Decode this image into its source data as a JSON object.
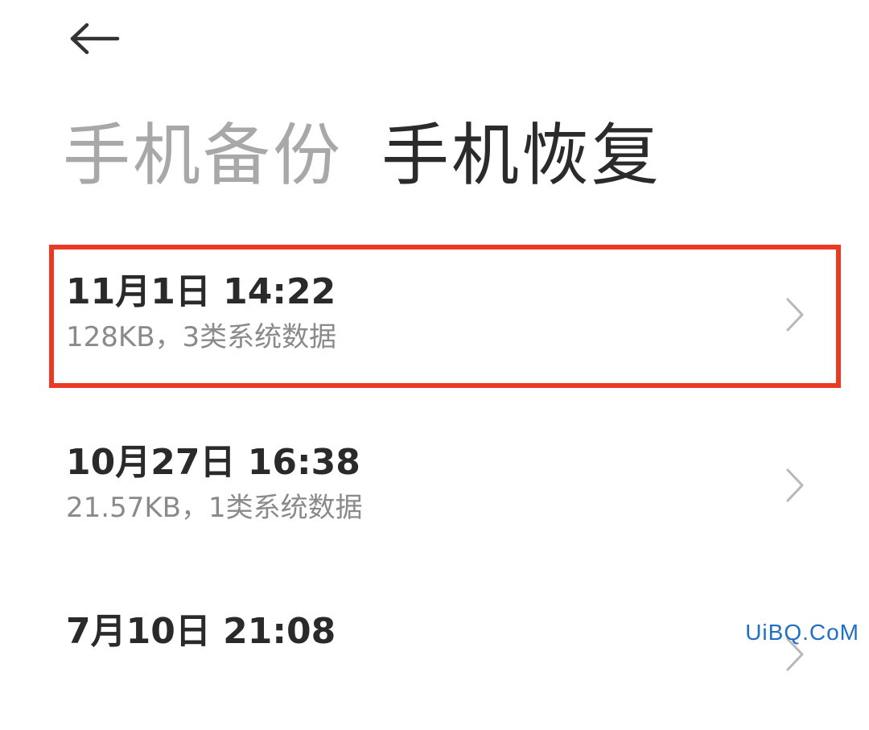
{
  "header": {
    "back_icon": "arrow-left-icon"
  },
  "tabs": [
    {
      "label": "手机备份",
      "active": false
    },
    {
      "label": "手机恢复",
      "active": true
    }
  ],
  "records": [
    {
      "title": "11月1日 14:22",
      "subtitle": "128KB，3类系统数据",
      "highlighted": true
    },
    {
      "title": "10月27日 16:38",
      "subtitle": "21.57KB，1类系统数据",
      "highlighted": false
    },
    {
      "title": "7月10日 21:08",
      "subtitle": "",
      "highlighted": false
    }
  ],
  "colors": {
    "highlight_border": "#ea3a24",
    "watermark": "#1f6fc5"
  },
  "watermark": "UiBQ.CoM"
}
